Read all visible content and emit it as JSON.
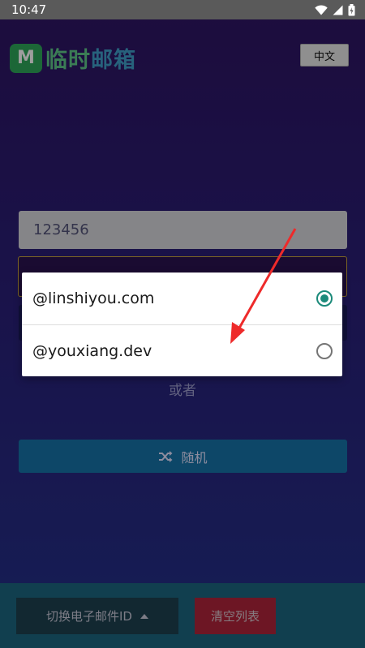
{
  "status_bar": {
    "time": "10:47"
  },
  "app": {
    "logo": {
      "badge": "M",
      "text_part1": "临时",
      "text_part2": "邮箱"
    },
    "language_button": "中文",
    "name_input": {
      "value": "123456"
    },
    "or_label": "或者",
    "random_button": "随机",
    "bottom_bar": {
      "switch_button": "切换电子邮件ID",
      "clear_button": "清空列表"
    }
  },
  "dropdown": {
    "options": [
      {
        "label": "@linshiyou.com",
        "selected": true
      },
      {
        "label": "@youxiang.dev",
        "selected": false
      }
    ]
  },
  "colors": {
    "accent_radio": "#1b8a7a",
    "annotation_arrow": "#ee2a2a",
    "random_button": "#1673a9",
    "clear_button": "#b0253a",
    "logo_green": "#2ea65a"
  }
}
